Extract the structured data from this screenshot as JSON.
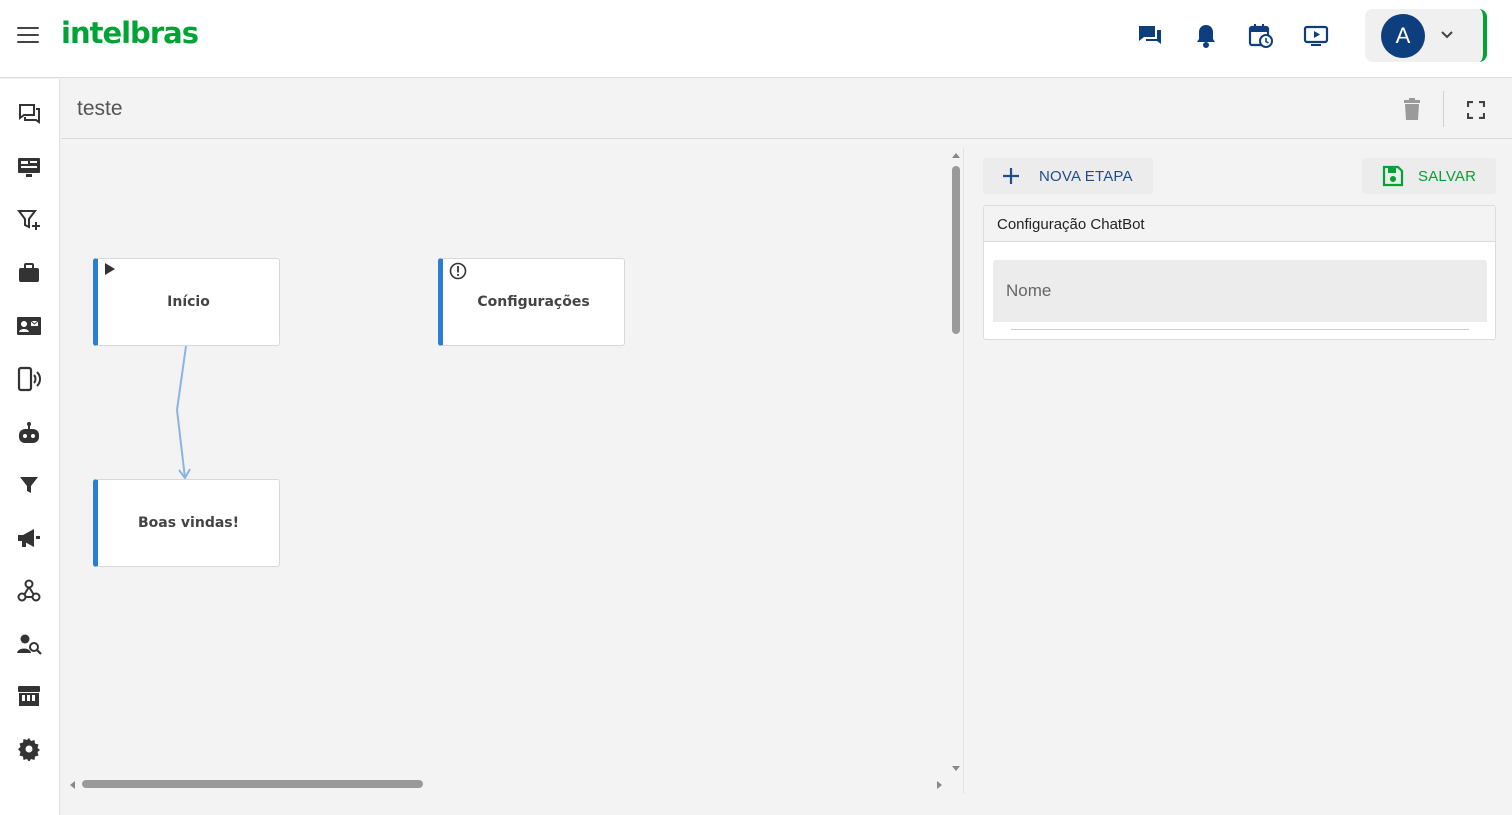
{
  "brand": {
    "logo_text": "intelbras",
    "accent": "#00a335",
    "primary": "#0d3e7d",
    "node_accent": "#2a7fd4"
  },
  "topbar": {
    "icons": [
      "chat-icon",
      "bell-icon",
      "calendar-clock-icon",
      "play-screen-icon"
    ],
    "user": {
      "avatar_letter": "A"
    }
  },
  "sidebar": {
    "items": [
      "conversations-icon",
      "dashboard-icon",
      "filter-add-icon",
      "briefcase-icon",
      "contact-card-icon",
      "phone-broadcast-icon",
      "robot-icon",
      "filter-icon",
      "megaphone-icon",
      "webhook-icon",
      "user-search-icon",
      "store-icon",
      "settings-icon"
    ]
  },
  "page": {
    "title": "teste"
  },
  "canvas": {
    "nodes": [
      {
        "label": "Início",
        "icon": "play-icon"
      },
      {
        "label": "Configurações",
        "icon": "alert-circle-icon"
      },
      {
        "label": "Boas vindas!",
        "icon": ""
      }
    ]
  },
  "panel": {
    "new_step_label": "NOVA ETAPA",
    "save_label": "SALVAR",
    "config_title": "Configuração ChatBot",
    "name_field_label": "Nome",
    "name_field_value": ""
  }
}
